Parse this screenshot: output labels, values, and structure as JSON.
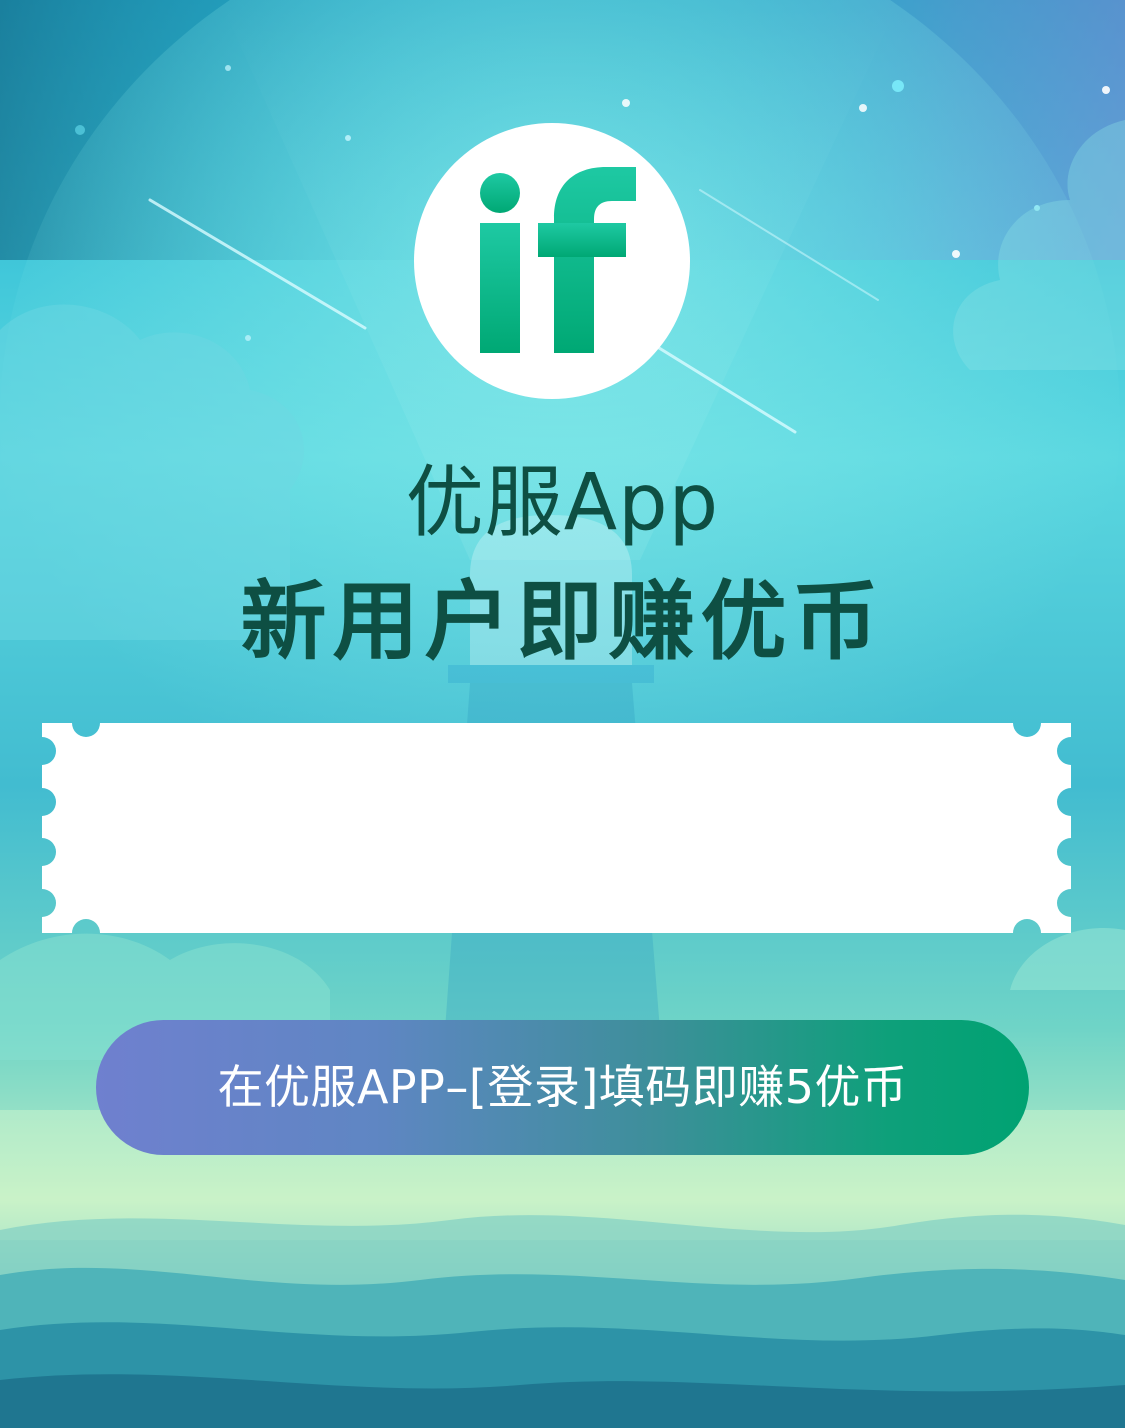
{
  "app": {
    "logo_icon": "if-logo-icon",
    "name_line": "优服App",
    "headline": "新用户即赚优币"
  },
  "ticket": {
    "invite_code": ""
  },
  "cta": {
    "label": "在优服APP–[登录]填码即赚5优币"
  },
  "colors": {
    "brand_green": "#00a272",
    "title_dark_green": "#0e4f43",
    "cta_gradient_start": "#6f80cf",
    "cta_gradient_end": "#00a272"
  }
}
